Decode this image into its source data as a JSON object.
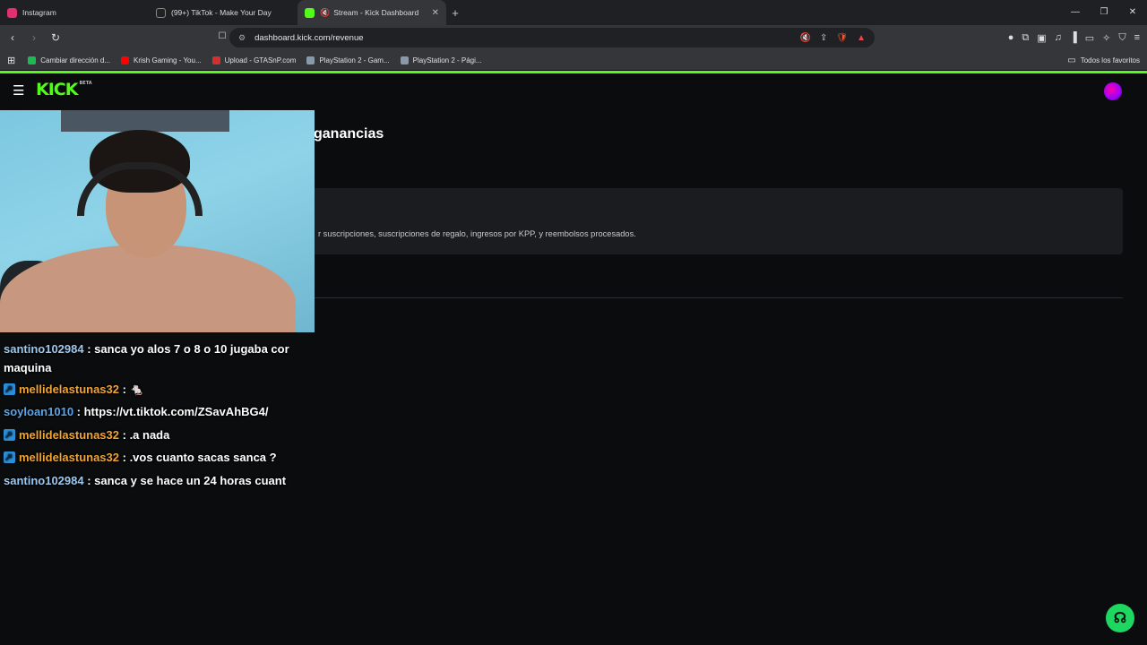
{
  "browser": {
    "tabs": [
      {
        "label": "Instagram",
        "color": "#e1306c"
      },
      {
        "label": "(99+) TikTok - Make Your Day",
        "color": "#ffffff"
      },
      {
        "label": "Stream - Kick Dashboard",
        "color": "#53fc18"
      }
    ],
    "new_tab": "+",
    "close_tab": "✕",
    "url": "dashboard.kick.com/revenue",
    "bookmarks": [
      {
        "label": "Cambiar dirección d...",
        "color": "#1db954"
      },
      {
        "label": "Krish Gaming - You...",
        "color": "#ff0000"
      },
      {
        "label": "Upload - GTASnP.com",
        "color": "#d32f2f"
      },
      {
        "label": "PlayStation 2 - Gam...",
        "color": "#8899aa"
      },
      {
        "label": "PlayStation 2 - Pági...",
        "color": "#8899aa"
      }
    ],
    "favorites_label": "Todos los favoritos"
  },
  "kick": {
    "logo": "KICK",
    "logo_tag": "BETA",
    "page_title_partial": "ganancias",
    "card_text_partial": "r suscripciones, suscripciones de regalo, ingresos por KPP, y reembolsos procesados.",
    "accent": "#53fc18"
  },
  "chat": {
    "messages": [
      {
        "user": "santino102984",
        "text": "sanca yo alos 7 o 8 o 10 jugaba cor",
        "cont": "maquina",
        "badge": false,
        "color": "u1"
      },
      {
        "user": "mellidelastunas32",
        "text": "🐁",
        "badge": true,
        "color": "u2"
      },
      {
        "user": "soyloan1010",
        "text": "https://vt.tiktok.com/ZSavAhBG4/",
        "badge": false,
        "color": "u3"
      },
      {
        "user": "mellidelastunas32",
        "text": ".a nada",
        "badge": true,
        "color": "u2"
      },
      {
        "user": "mellidelastunas32",
        "text": ".vos cuanto sacas sanca ?",
        "badge": true,
        "color": "u2"
      },
      {
        "user": "santino102984",
        "text": "sanca y se hace un 24 horas cuant",
        "badge": false,
        "color": "u1"
      }
    ]
  }
}
